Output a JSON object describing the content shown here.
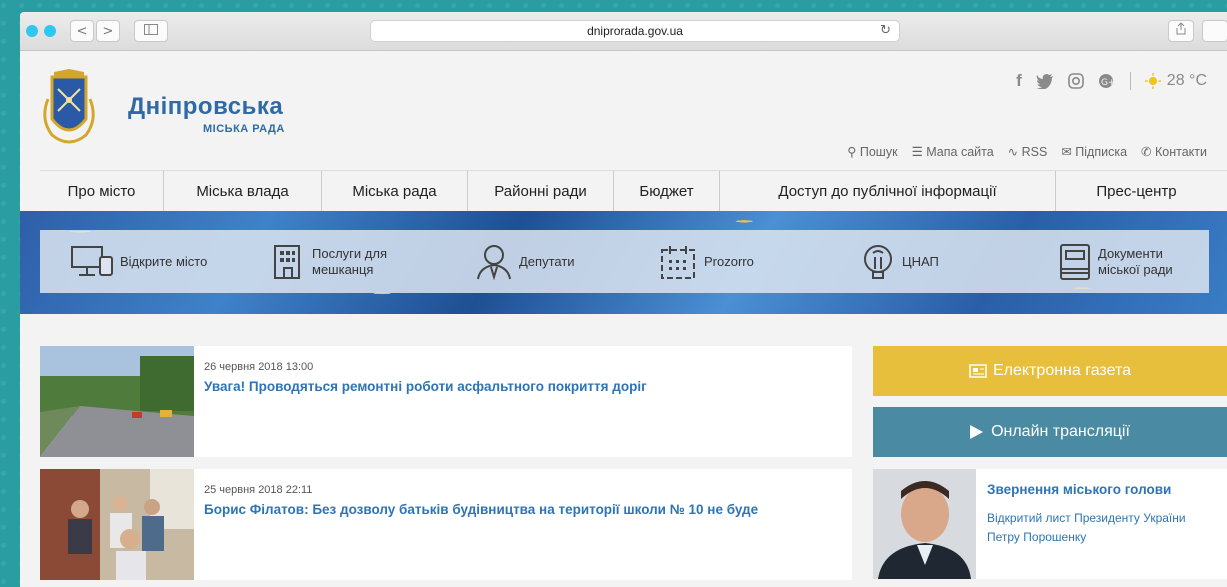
{
  "browser": {
    "url": "dniprorada.gov.ua",
    "back": "<",
    "forward": ">"
  },
  "brand": {
    "name": "Дніпровська",
    "subtitle": "МІСЬКА РАДА"
  },
  "weather": {
    "temp": "28 °C"
  },
  "utility_links": [
    {
      "icon": "search-icon",
      "label": "Пошук"
    },
    {
      "icon": "sitemap-icon",
      "label": "Мапа сайта"
    },
    {
      "icon": "rss-icon",
      "label": "RSS"
    },
    {
      "icon": "mail-icon",
      "label": "Підписка"
    },
    {
      "icon": "phone-icon",
      "label": "Контакти"
    }
  ],
  "main_nav": [
    "Про місто",
    "Міська влада",
    "Міська рада",
    "Районні ради",
    "Бюджет",
    "Доступ до публічної інформації",
    "Прес-центр"
  ],
  "shortcuts": [
    {
      "icon": "monitor-icon",
      "label": "Відкрите місто"
    },
    {
      "icon": "building-icon",
      "label": "Послуги для мешканця"
    },
    {
      "icon": "person-icon",
      "label": "Депутати"
    },
    {
      "icon": "calendar-icon",
      "label": "Prozorro"
    },
    {
      "icon": "lightbulb-icon",
      "label": "ЦНАП"
    },
    {
      "icon": "document-icon",
      "label": "Документи міської ради"
    }
  ],
  "news": [
    {
      "date": "26 червня 2018 13:00",
      "title": "Увага! Проводяться ремонтні роботи асфальтного покриття доріг"
    },
    {
      "date": "25 червня 2018 22:11",
      "title": "Борис Філатов: Без дозволу батьків будівництва на території школи № 10 не буде"
    }
  ],
  "sidebar": {
    "gazeta": "Електронна газета",
    "live": "Онлайн трансляції",
    "mayor_heading": "Звернення міського голови",
    "mayor_text": "Відкритий лист Президенту України Петру Порошенку"
  },
  "colors": {
    "accent_blue": "#2e74b5",
    "gold": "#e7bf3c",
    "teal": "#4a8ba3"
  }
}
